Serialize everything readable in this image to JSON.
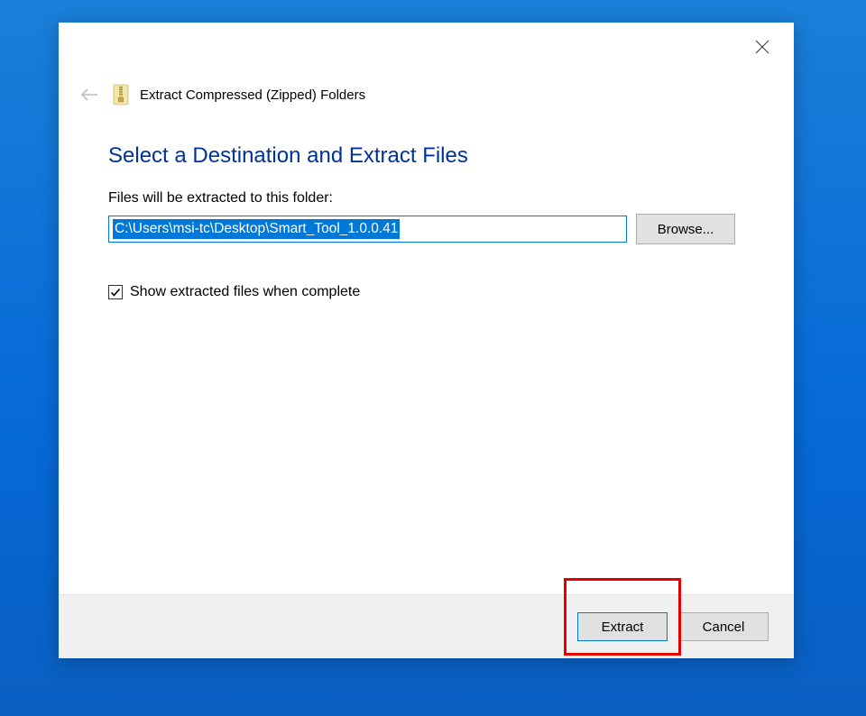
{
  "wizard": {
    "title": "Extract Compressed (Zipped) Folders",
    "heading": "Select a Destination and Extract Files",
    "field_label": "Files will be extracted to this folder:",
    "path_value": "C:\\Users\\msi-tc\\Desktop\\Smart_Tool_1.0.0.41",
    "browse_label": "Browse...",
    "checkbox_label": "Show extracted files when complete",
    "checkbox_checked": true
  },
  "footer": {
    "extract_label": "Extract",
    "cancel_label": "Cancel"
  }
}
